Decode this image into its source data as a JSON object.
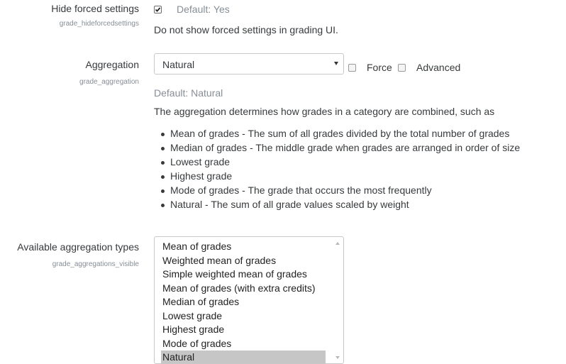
{
  "hide_forced": {
    "label": "Hide forced settings",
    "sublabel": "grade_hideforcedsettings",
    "checked": true,
    "default_text": "Default: Yes",
    "description": "Do not show forced settings in grading UI."
  },
  "aggregation": {
    "label": "Aggregation",
    "sublabel": "grade_aggregation",
    "selected_value": "Natural",
    "force_label": "Force",
    "advanced_label": "Advanced",
    "default_text": "Default: Natural",
    "description": "The aggregation determines how grades in a category are combined, such as",
    "bullets": [
      "Mean of grades - The sum of all grades divided by the total number of grades",
      "Median of grades - The middle grade when grades are arranged in order of size",
      "Lowest grade",
      "Highest grade",
      "Mode of grades - The grade that occurs the most frequently",
      "Natural - The sum of all grade values scaled by weight"
    ]
  },
  "available_types": {
    "label": "Available aggregation types",
    "sublabel": "grade_aggregations_visible",
    "options": [
      "Mean of grades",
      "Weighted mean of grades",
      "Simple weighted mean of grades",
      "Mean of grades (with extra credits)",
      "Median of grades",
      "Lowest grade",
      "Highest grade",
      "Mode of grades",
      "Natural"
    ],
    "selected": [
      "Natural"
    ]
  },
  "colors": {
    "text": "#373a3c",
    "muted": "#868e96",
    "border": "#c8c8c8",
    "selected_option_bg": "#c6c6c6"
  },
  "icons": {
    "checkbox_checked": "checkmark-icon",
    "dropdown": "chevron-down-icon",
    "scroll_up": "scroll-up-icon",
    "scroll_down": "scroll-down-icon"
  }
}
